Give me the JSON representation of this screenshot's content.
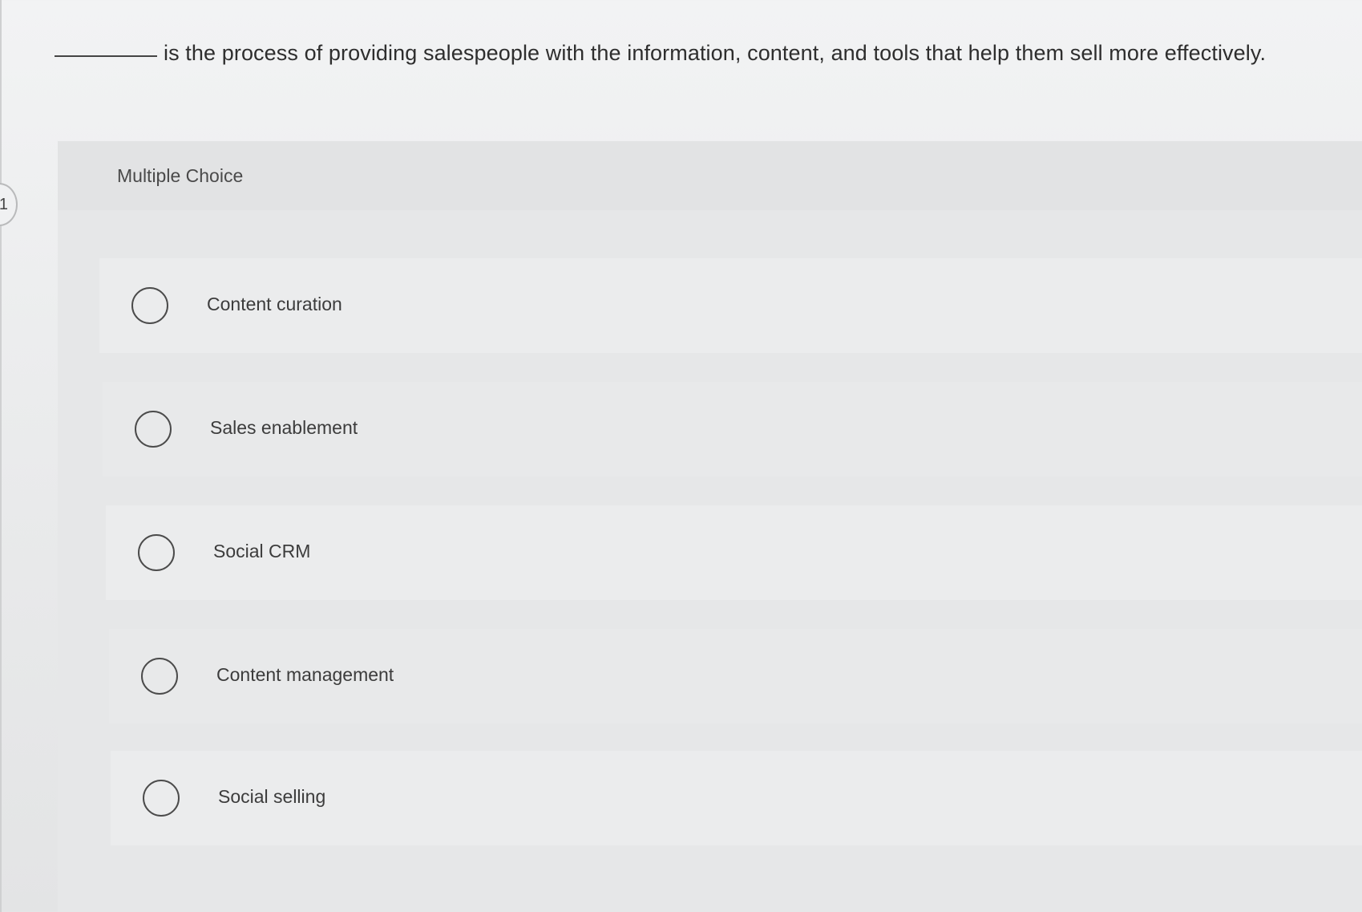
{
  "question": {
    "number": "1",
    "text": "is the process of providing salespeople with the information, content, and tools that help them sell more effectively."
  },
  "answer_section": {
    "label": "Multiple Choice",
    "options": [
      {
        "label": "Content curation",
        "selected": false
      },
      {
        "label": "Sales enablement",
        "selected": false
      },
      {
        "label": "Social CRM",
        "selected": false
      },
      {
        "label": "Content management",
        "selected": false
      },
      {
        "label": "Social selling",
        "selected": false
      }
    ]
  }
}
